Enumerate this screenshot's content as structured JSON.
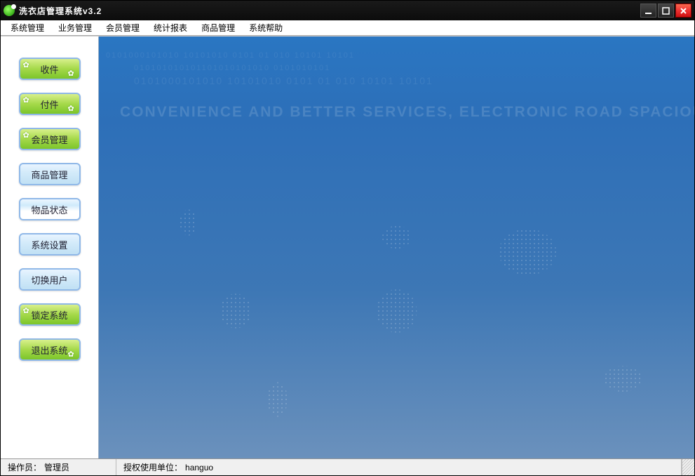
{
  "title": "洗衣店管理系统v3.2",
  "menu": {
    "system": "系统管理",
    "business": "业务管理",
    "member": "会员管理",
    "report": "统计报表",
    "product": "商品管理",
    "help": "系统帮助"
  },
  "sidebar": {
    "receive": "收件",
    "deliver": "付件",
    "member_mgmt": "会员管理",
    "product_mgmt": "商品管理",
    "item_status": "物品状态",
    "system_settings": "系统设置",
    "switch_user": "切换用户",
    "lock_system": "锁定系统",
    "exit_system": "退出系统"
  },
  "banner": {
    "tagline": "CONVENIENCE AND BETTER SERVICES, ELECTRONIC ROAD SPACIOUS, CREATING THE MOST COMPETITIVE",
    "bin1": "0101000101010 10101010   0101   01  010  10101  10101",
    "bin2": "010101010101101010101010  0101010101",
    "bin3": "0101000101010 10101010   0101   01  010  10101  10101"
  },
  "status": {
    "operator_label": "操作员：",
    "operator_value": "管理员",
    "license_label": "授权使用单位：",
    "license_value": "hanguo"
  }
}
